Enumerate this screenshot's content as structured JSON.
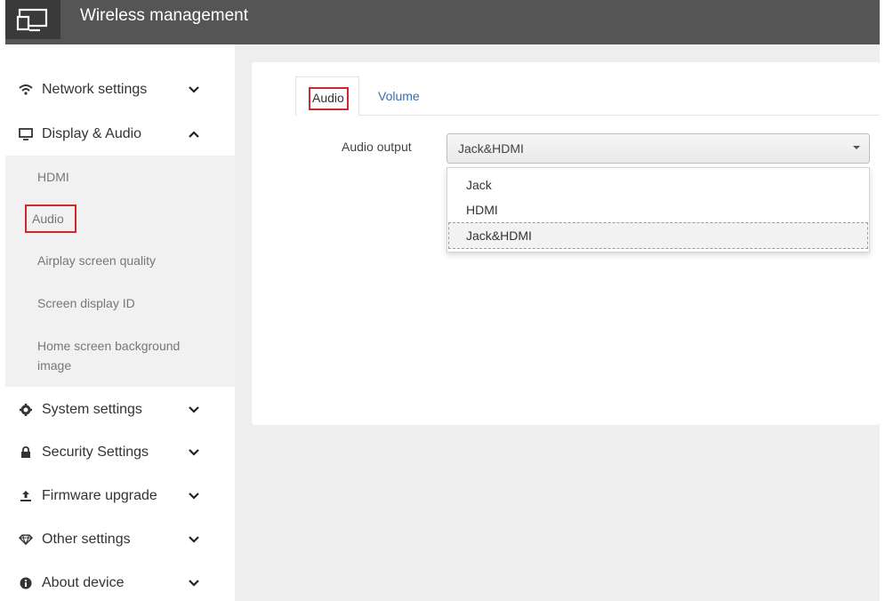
{
  "header": {
    "title": "Wireless management"
  },
  "sidebar": {
    "groups": [
      {
        "label": "Network settings",
        "icon": "wifi-icon"
      },
      {
        "label": "Display & Audio",
        "icon": "monitor-icon"
      },
      {
        "label": "System settings",
        "icon": "gear-icon"
      },
      {
        "label": "Security Settings",
        "icon": "lock-icon"
      },
      {
        "label": "Firmware upgrade",
        "icon": "upload-icon"
      },
      {
        "label": "Other settings",
        "icon": "diamond-icon"
      },
      {
        "label": "About device",
        "icon": "info-icon"
      }
    ],
    "display_audio_items": [
      {
        "label": "HDMI"
      },
      {
        "label": "Audio"
      },
      {
        "label": "Airplay screen quality"
      },
      {
        "label": "Screen display ID"
      },
      {
        "label": "Home screen background image"
      }
    ]
  },
  "tabs": [
    {
      "label": "Audio"
    },
    {
      "label": "Volume"
    }
  ],
  "form": {
    "audio_output_label": "Audio output",
    "audio_output_value": "Jack&HDMI",
    "options": [
      "Jack",
      "HDMI",
      "Jack&HDMI"
    ]
  },
  "colors": {
    "header": "#555555",
    "highlight": "#d0282b",
    "link": "#3a6ea8"
  }
}
